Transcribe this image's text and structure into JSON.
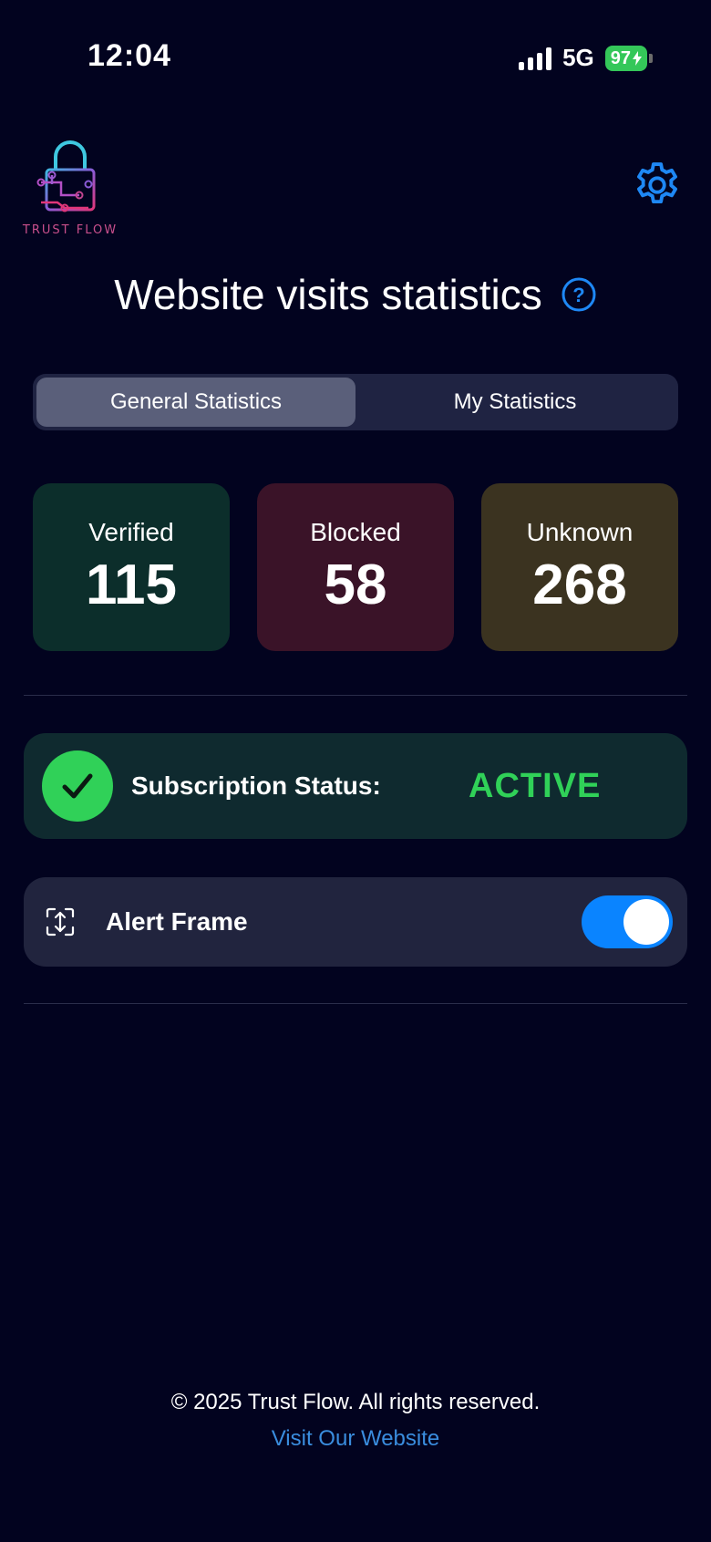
{
  "status_bar": {
    "time": "12:04",
    "network": "5G",
    "battery": "97"
  },
  "header": {
    "logo_text": "TRUST FLOW",
    "title": "Website visits statistics"
  },
  "tabs": [
    {
      "label": "General Statistics",
      "active": true
    },
    {
      "label": "My Statistics",
      "active": false
    }
  ],
  "stats": [
    {
      "label": "Verified",
      "value": "115",
      "color": "#0c2e2b"
    },
    {
      "label": "Blocked",
      "value": "58",
      "color": "#3a1328"
    },
    {
      "label": "Unknown",
      "value": "268",
      "color": "#3b3320"
    }
  ],
  "subscription": {
    "label": "Subscription Status:",
    "status": "ACTIVE",
    "status_color": "#30d158"
  },
  "alert_frame": {
    "label": "Alert Frame",
    "enabled": true
  },
  "footer": {
    "copyright": "© 2025 Trust Flow. All rights reserved.",
    "link": "Visit Our Website"
  },
  "colors": {
    "background": "#02031f",
    "accent": "#0a84ff",
    "link": "#3a8dde"
  }
}
